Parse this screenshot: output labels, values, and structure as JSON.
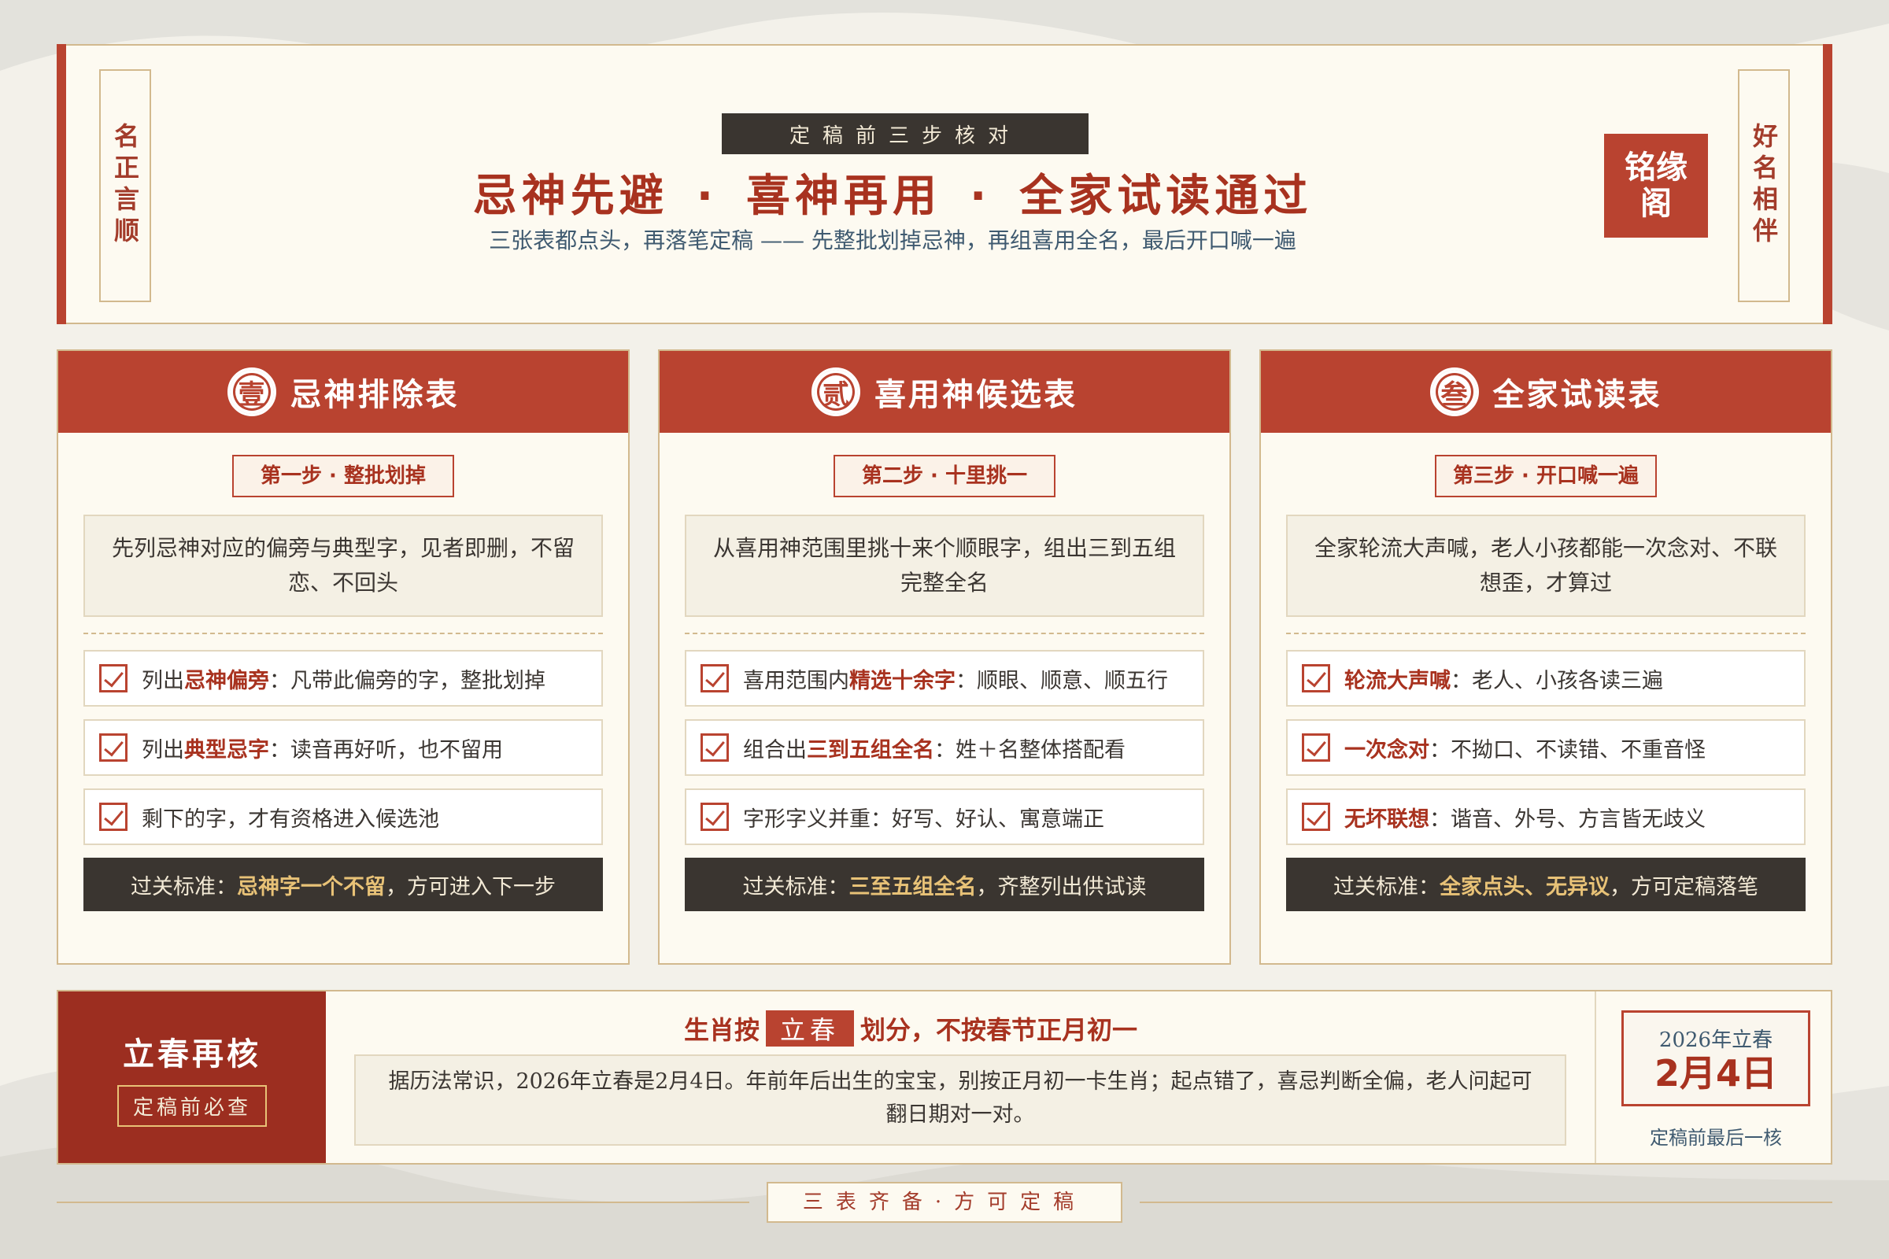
{
  "header": {
    "left_tag": "名正言顺",
    "right_tag": "好名相伴",
    "kicker": "定稿前三步核对",
    "headline": [
      "忌神先避",
      "喜神再用",
      "全家试读通过"
    ],
    "headline_sep": "·",
    "subline": "三张表都点头，再落笔定稿 —— 先整批划掉忌神，再组喜用全名，最后开口喊一遍",
    "seal": "铭缘阁"
  },
  "cards": [
    {
      "number": "壹",
      "title": "忌神排除表",
      "step": "第一步 · 整批划掉",
      "desc": "先列忌神对应的偏旁与典型字，见者即删，不留恋、不回头",
      "items": [
        {
          "pre": "列出",
          "hl": "忌神偏旁",
          "post": "：凡带此偏旁的字，整批划掉"
        },
        {
          "pre": "列出",
          "hl": "典型忌字",
          "post": "：读音再好听，也不留用"
        },
        {
          "pre": "剩下的字，才有资格进入候选池",
          "hl": "",
          "post": ""
        }
      ],
      "pass": {
        "pre": "过关标准：",
        "hl": "忌神字一个不留",
        "post": "，方可进入下一步"
      }
    },
    {
      "number": "贰",
      "title": "喜用神候选表",
      "step": "第二步 · 十里挑一",
      "desc": "从喜用神范围里挑十来个顺眼字，组出三到五组完整全名",
      "items": [
        {
          "pre": "喜用范围内",
          "hl": "精选十余字",
          "post": "：顺眼、顺意、顺五行"
        },
        {
          "pre": "组合出",
          "hl": "三到五组全名",
          "post": "：姓＋名整体搭配看"
        },
        {
          "pre": "字形字义并重：好写、好认、寓意端正",
          "hl": "",
          "post": ""
        }
      ],
      "pass": {
        "pre": "过关标准：",
        "hl": "三至五组全名",
        "post": "，齐整列出供试读"
      }
    },
    {
      "number": "叁",
      "title": "全家试读表",
      "step": "第三步 · 开口喊一遍",
      "desc": "全家轮流大声喊，老人小孩都能一次念对、不联想歪，才算过",
      "items": [
        {
          "pre": "",
          "hl": "轮流大声喊",
          "post": "：老人、小孩各读三遍"
        },
        {
          "pre": "",
          "hl": "一次念对",
          "post": "：不拗口、不读错、不重音怪"
        },
        {
          "pre": "",
          "hl": "无坏联想",
          "post": "：谐音、外号、方言皆无歧义"
        }
      ],
      "pass": {
        "pre": "过关标准：",
        "hl": "全家点头、无异议",
        "post": "，方可定稿落笔"
      }
    }
  ],
  "band": {
    "title": "立春再核",
    "subtitle": "定稿前必查",
    "heading_pre": "生肖按",
    "heading_tag": "立春",
    "heading_post": "划分，不按春节正月初一",
    "text": "据历法常识，2026年立春是2月4日。年前年后出生的宝宝，别按正月初一卡生肖；起点错了，喜忌判断全偏，老人问起可翻日期对一对。",
    "date_year": "2026年立春",
    "date_day": "2月4日",
    "date_note": "定稿前最后一核"
  },
  "footer": {
    "tag": "三表齐备·方可定稿"
  },
  "colors": {
    "accent": "#b94330",
    "dark": "#3a3530",
    "gold": "#e8c277",
    "border": "#d2b98e"
  }
}
